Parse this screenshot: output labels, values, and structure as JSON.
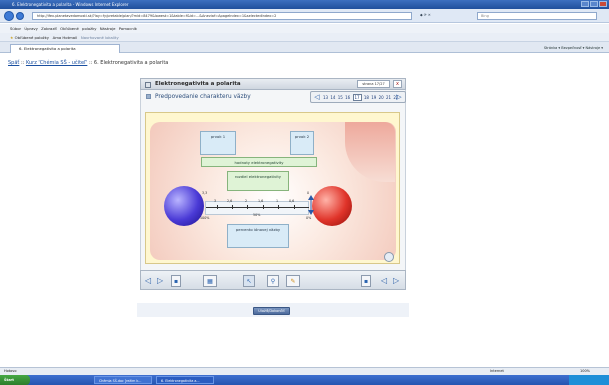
{
  "window": {
    "title": "6. Elektronegativita a polarita - Windows Internet Explorer"
  },
  "browser": {
    "url": "http://ifex.planetavedomosti.sk/?lay=fy/pretable/plan/?mid=8479&lowest=1&table=f&id=...&Aneviaf=ApageIndex=1&selectedIndex=2",
    "search_placeholder": "Bing",
    "menu": [
      "Súbor",
      "Úpravy",
      "Zobraziť",
      "Obľúbené položky",
      "Nástroje",
      "Pomocník"
    ],
    "favorites": [
      "Obľúbené položky",
      "Ama Hotmail",
      "Navrhované lokality"
    ],
    "tab_label": "6. Elektronegativita a polarita",
    "command_bar": "Stránka ▾   Bezpečnosť ▾   Nástroje ▾"
  },
  "breadcrumb": {
    "back": "Späť",
    "sep": "::",
    "course": "Kurz 'Chémia SŠ - učiteľ'",
    "current": "6. Elektronegativita a polarita"
  },
  "panel": {
    "title": "Elektronegativita a polarita",
    "page_indicator": "strana 17/27",
    "close": "x",
    "subtitle": "Predpovedanie charakteru väzby",
    "pager_numbers": [
      "13",
      "14",
      "15",
      "16"
    ],
    "pager_current": "17",
    "pager_after": [
      "18",
      "19",
      "20",
      "21",
      "22"
    ]
  },
  "sim": {
    "prvok1": "prvok 1",
    "prvok2": "prvok 2",
    "hodnoty": "hodnoty elektronegativity",
    "rozdiel": "rozdiel elektronegativity",
    "percento": "percento iónovej väzby",
    "scale_left": "3,3",
    "scale_right": "0",
    "ticks": [
      "3",
      "2,6",
      "2",
      "1,6",
      "1",
      "0,6"
    ],
    "pct_left": "100%",
    "pct_mid": "50%",
    "pct_right": "0%"
  },
  "toolbar": {
    "prev": "◁",
    "next": "▷"
  },
  "submit_label": "Uložiť/Dokončiť",
  "statusbar": {
    "left": "Hotovo",
    "zone": "Internet",
    "zoom": "100%"
  },
  "taskbar": {
    "start": "Štart",
    "tasks": [
      "Chémia SŠ.doc [režim k...",
      "6. Elektronegativita a..."
    ],
    "clock": ""
  }
}
